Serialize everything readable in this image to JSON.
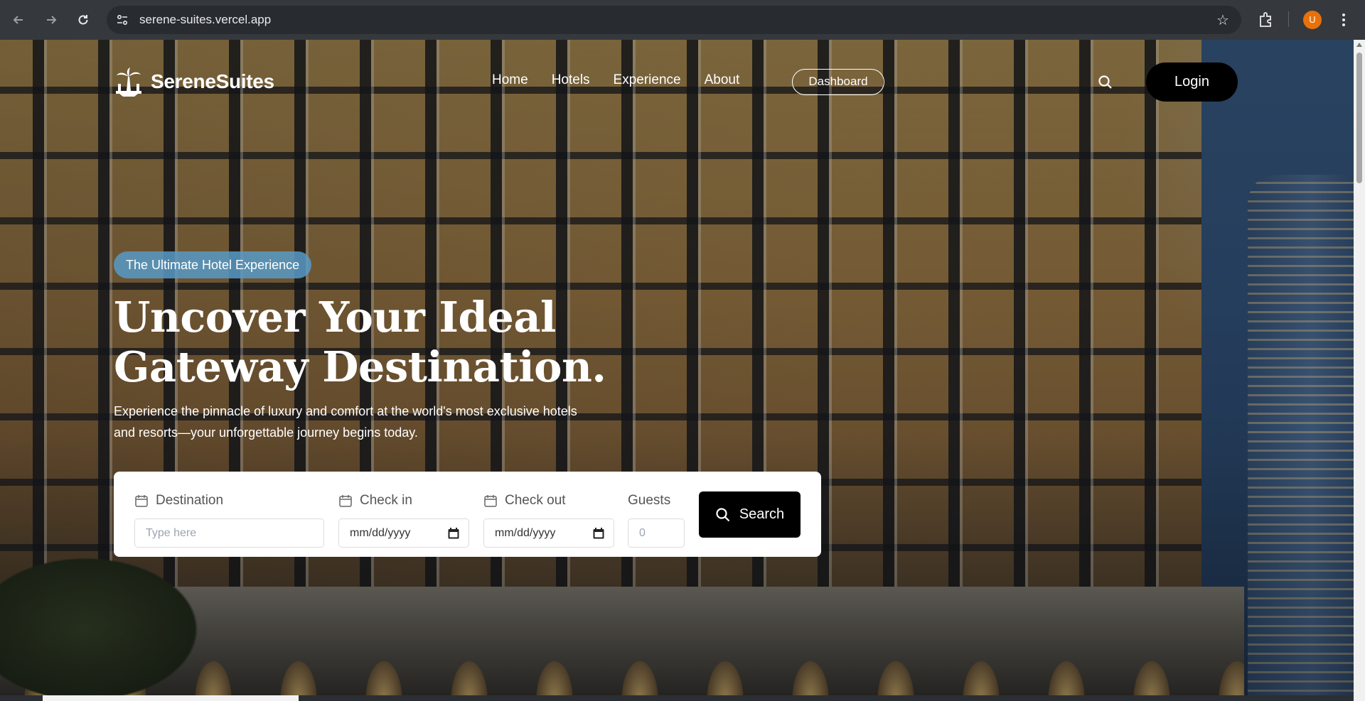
{
  "browser": {
    "url": "serene-suites.vercel.app",
    "profile_initial": "U",
    "colors": {
      "chrome": "#35393d",
      "omnibox": "#282c30",
      "avatar": "#e8710a"
    }
  },
  "site": {
    "brand": "SereneSuites",
    "menu": [
      {
        "label": "Home"
      },
      {
        "label": "Hotels"
      },
      {
        "label": "Experience"
      },
      {
        "label": "About"
      }
    ],
    "dashboard_label": "Dashboard",
    "login_label": "Login"
  },
  "hero": {
    "badge": "The Ultimate Hotel Experience",
    "headline_line1": "Uncover Your Ideal",
    "headline_line2": "Gateway Destination.",
    "subtext": "Experience the pinnacle of luxury and comfort at the world's most exclusive hotels and resorts—your unforgettable journey begins today."
  },
  "search": {
    "destination_label": "Destination",
    "destination_placeholder": "Type here",
    "checkin_label": "Check in",
    "checkin_value": "mm/dd/yyyy",
    "checkout_label": "Check out",
    "checkout_value": "mm/dd/yyyy",
    "guests_label": "Guests",
    "guests_placeholder": "0",
    "button_label": "Search"
  },
  "icons": [
    "back-icon",
    "forward-icon",
    "reload-icon",
    "site-info-icon",
    "bookmark-star-icon",
    "extensions-icon",
    "menu-kebab-icon",
    "palm-logo-icon",
    "search-icon",
    "calendar-icon"
  ]
}
